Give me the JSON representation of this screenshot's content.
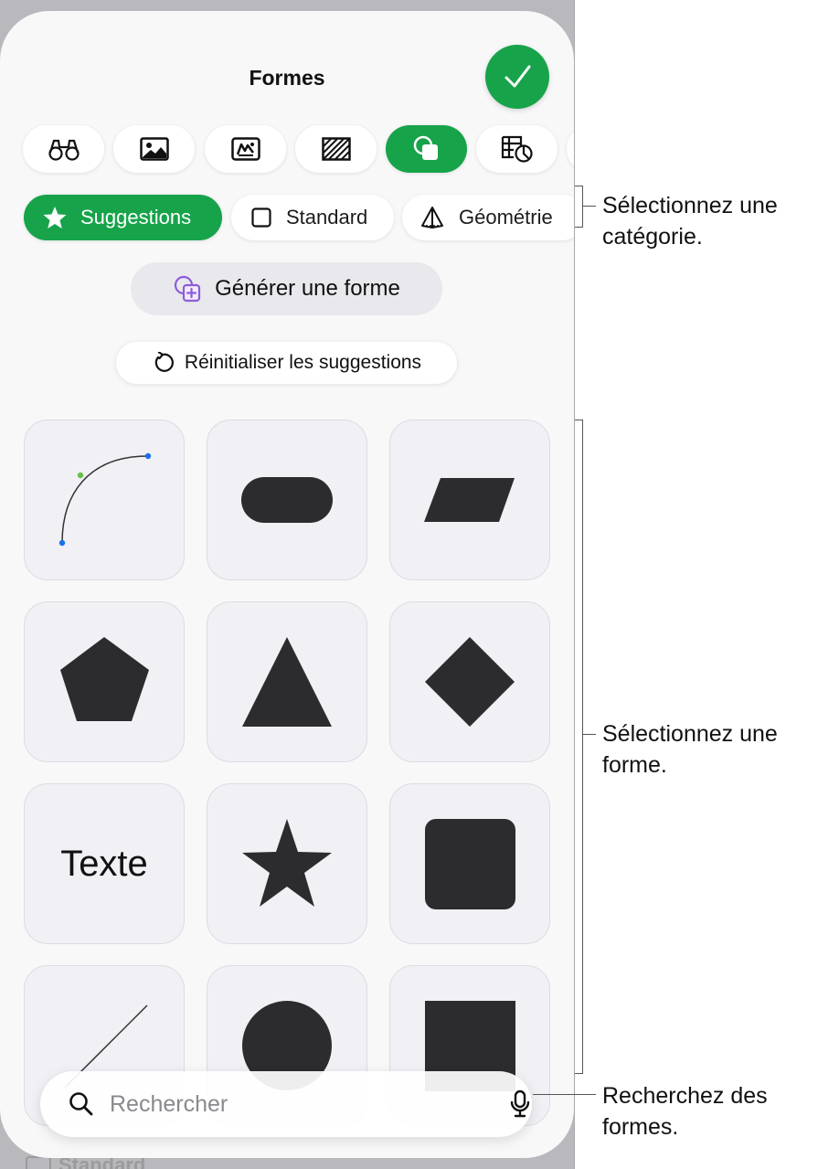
{
  "panel": {
    "title": "Formes",
    "done_icon": "checkmark-icon",
    "accent_color": "#17a34a"
  },
  "tabs": [
    {
      "icon": "binoculars-icon",
      "active": false
    },
    {
      "icon": "image-icon",
      "active": false
    },
    {
      "icon": "sticker-icon",
      "active": false
    },
    {
      "icon": "pattern-icon",
      "active": false
    },
    {
      "icon": "shapes-icon",
      "active": true
    },
    {
      "icon": "table-chart-icon",
      "active": false
    }
  ],
  "categories": [
    {
      "label": "Suggestions",
      "icon": "star-icon",
      "active": true
    },
    {
      "label": "Standard",
      "icon": "square-icon",
      "active": false
    },
    {
      "label": "Géométrie",
      "icon": "pyramid-icon",
      "active": false
    }
  ],
  "actions": {
    "generate_label": "Générer une forme",
    "reset_label": "Réinitialiser les suggestions"
  },
  "shapes": [
    "curve",
    "rounded-rectangle",
    "parallelogram",
    "pentagon",
    "triangle",
    "diamond",
    "text",
    "star",
    "rounded-square",
    "line",
    "circle",
    "square"
  ],
  "shape_text_label": "Texte",
  "search": {
    "placeholder": "Rechercher"
  },
  "background_chip_label": "Standard",
  "callouts": {
    "category": "Sélectionnez une catégorie.",
    "shape": "Sélectionnez une forme.",
    "search": "Recherchez des formes."
  }
}
